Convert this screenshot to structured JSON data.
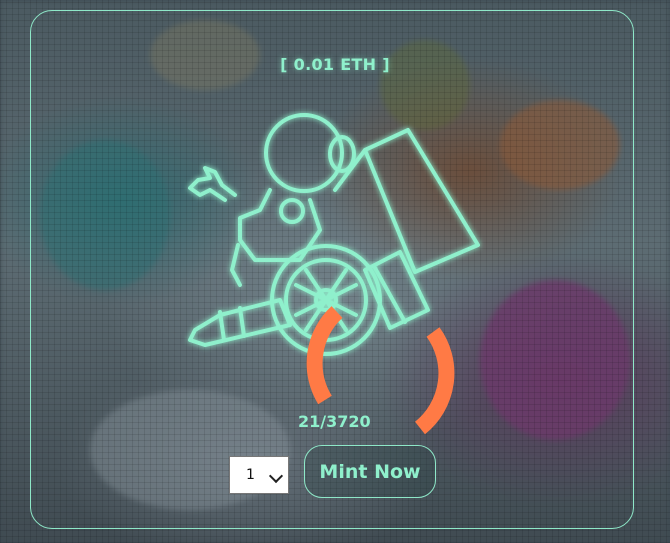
{
  "mint": {
    "price_label": "[ 0.01 ETH ]",
    "minted_count": "21/3720",
    "quantity_selected": "1",
    "mint_button_label": "Mint Now",
    "progress_fraction": 0.0056
  },
  "colors": {
    "accent": "#8ff0cc",
    "spinner": "#ff7a45",
    "border": "#8ee8c8"
  },
  "icons": {
    "artwork": "neon-robot-cannon-icon",
    "spinner": "loading-spinner-icon",
    "select_chevron": "chevron-down-icon"
  }
}
